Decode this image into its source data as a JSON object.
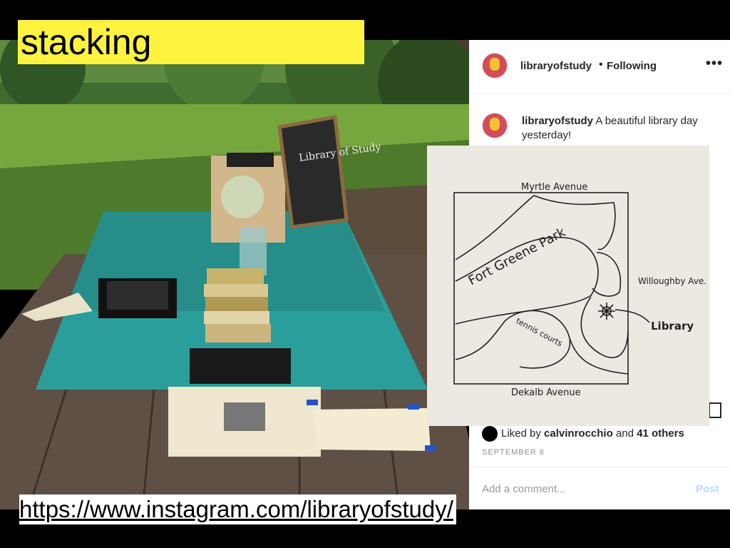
{
  "slide": {
    "title": "stacking",
    "url": "https://www.instagram.com/libraryofstudy/"
  },
  "photo": {
    "chalkboard_text": "Library of Study",
    "colors": {
      "tablecloth": "#2a9e9a",
      "grass": "#6ea33c",
      "wood": "#6b5a48"
    }
  },
  "instagram": {
    "username": "libraryofstudy",
    "separator": "•",
    "follow_status": "Following",
    "more": "•••",
    "caption_user": "libraryofstudy",
    "caption_text": "A beautiful library day yesterday!",
    "liked_prefix": "Liked by",
    "liked_user": "calvinrocchio",
    "liked_and": "and",
    "liked_others": "41 others",
    "date": "SEPTEMBER 6",
    "comment_placeholder": "Add a comment...",
    "post_label": "Post"
  },
  "map": {
    "top_street": "Myrtle Avenue",
    "bottom_street": "Dekalb Avenue",
    "right_street": "Willoughby Ave.",
    "park_name": "Fort Greene Park",
    "courts": "tennis courts",
    "library_label": "Library"
  }
}
